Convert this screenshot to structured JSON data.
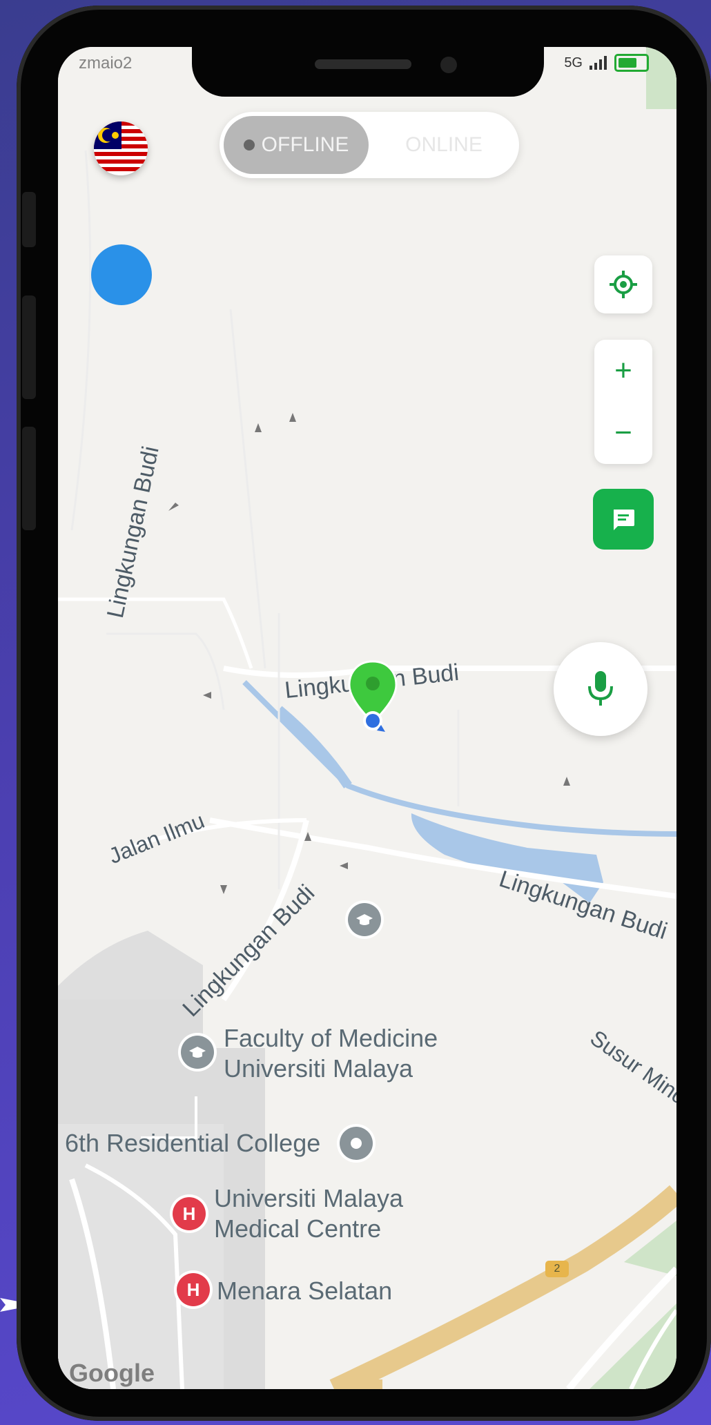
{
  "status_bar": {
    "left_text": "zmaio2",
    "network": "5G"
  },
  "toggle": {
    "offline_label": "OFFLINE",
    "online_label": "ONLINE",
    "active": "offline"
  },
  "map": {
    "roads": [
      {
        "name": "Lingkungan Budi",
        "id": "road-lingkungan-budi-left"
      },
      {
        "name": "Lingkungan Budi",
        "id": "road-lingkungan-budi-center"
      },
      {
        "name": "Jalan Ilmu",
        "id": "road-jalan-ilmu"
      },
      {
        "name": "Lingkungan Budi",
        "id": "road-lingkungan-budi-diag"
      },
      {
        "name": "Lingkungan Budi",
        "id": "road-lingkungan-budi-right"
      },
      {
        "name": "Susur Mind",
        "id": "road-susur-mind"
      }
    ],
    "pois": [
      {
        "name_line1": "Faculty of Medicine",
        "name_line2": "Universiti Malaya"
      },
      {
        "name_line1": "6th Residential College"
      },
      {
        "name_line1": "Universiti Malaya",
        "name_line2": "Medical Centre"
      },
      {
        "name_line1": "Menara Selatan"
      }
    ],
    "highway_badge": "2",
    "attribution": "Google"
  },
  "controls": {
    "locate_icon": "crosshair-icon",
    "zoom_in": "+",
    "zoom_out": "−",
    "chat_icon": "message-icon",
    "mic_icon": "microphone-icon"
  },
  "colors": {
    "accent": "#17b14c",
    "user_dot": "#2a91e8",
    "marker": "#3ec93e",
    "water": "#a9c7e8",
    "hospital": "#e23b4a"
  }
}
